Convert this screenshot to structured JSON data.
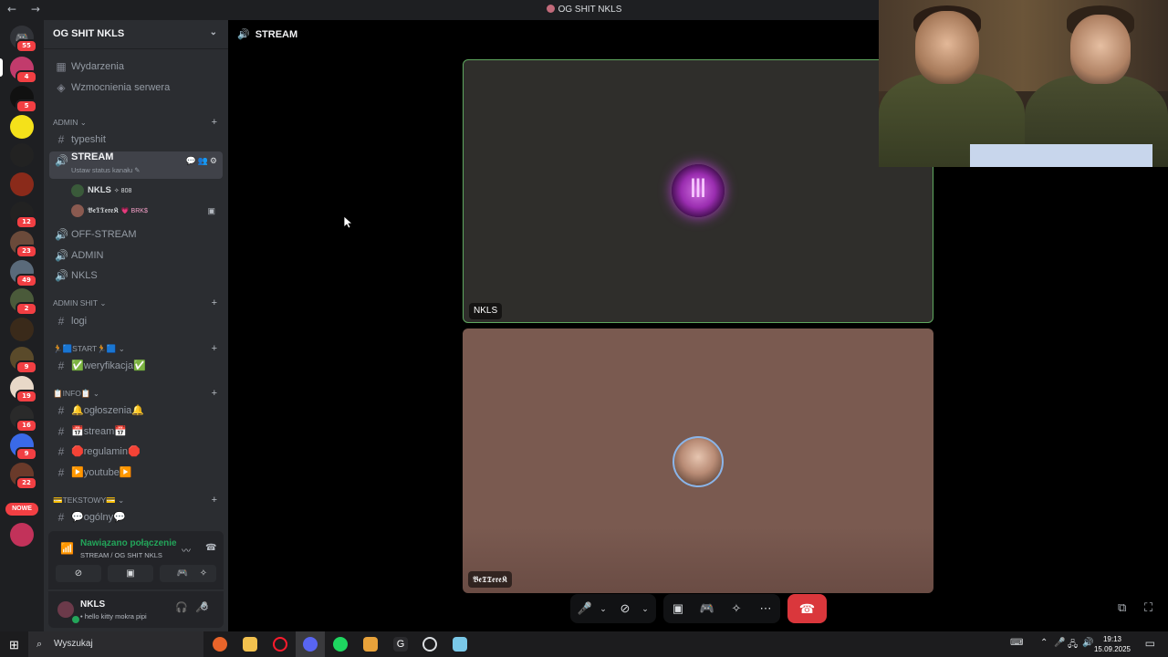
{
  "window": {
    "title": "OG SHIT NKLS",
    "nav_arrows": "← →"
  },
  "servers": {
    "home_badge": "55",
    "items": [
      {
        "badge": "4",
        "color": "#c23b6c"
      },
      {
        "badge": "5",
        "color": "#111111"
      },
      {
        "badge": "",
        "color": "#f4e11a"
      },
      {
        "badge": "",
        "color": "#222222"
      },
      {
        "badge": "",
        "color": "#8a2a1a"
      },
      {
        "badge": "12",
        "color": "#222222"
      },
      {
        "badge": "23",
        "color": "#6b4a3a"
      },
      {
        "badge": "49",
        "color": "#5a6a7a"
      },
      {
        "badge": "2",
        "color": "#4a5a3a"
      },
      {
        "badge": "",
        "color": "#3a2a1a"
      },
      {
        "badge": "9",
        "color": "#5a4a2a"
      },
      {
        "badge": "19",
        "color": "#e8d8c8"
      },
      {
        "badge": "16",
        "color": "#2a2a2a"
      },
      {
        "badge": "9",
        "color": "#3a6ae8"
      },
      {
        "badge": "22",
        "color": "#6a3a2a"
      }
    ],
    "new_label": "NOWE"
  },
  "sidebar": {
    "guild_name": "OG SHIT NKLS",
    "top_links": [
      {
        "label": "Wydarzenia",
        "icon": "calendar-icon"
      },
      {
        "label": "Wzmocnienia serwera",
        "icon": "boost-icon"
      }
    ],
    "categories": {
      "admin": "ADMIN",
      "admin_shit": "ADMIN SHIT",
      "start": "🏃🟦START🏃🟦",
      "info": "📋INFO📋",
      "tekstowy": "💳TEKSTOWY💳"
    },
    "channels": {
      "typeshit": "typeshit",
      "stream": "STREAM",
      "stream_sub": "Ustaw status kanału",
      "off_stream": "OFF-STREAM",
      "admin": "ADMIN",
      "nkls": "NKLS",
      "logi": "logi",
      "weryfikacja": "✅weryfikacja✅",
      "ogloszenia": "🔔ogłoszenia🔔",
      "stream_text": "📅stream📅",
      "regulamin": "🛑regulamin🛑",
      "youtube": "▶️youtube▶️",
      "ogolny": "💬ogólny💬"
    },
    "members": [
      {
        "name": "NKLS",
        "tag": "✧ 808",
        "color": "#3a5a3a"
      },
      {
        "name": "𝕭𝖊𝕿𝕿𝖊𝖗𝖊𝕶",
        "tag": "💗 BRK$",
        "color": "#8a5a50"
      }
    ],
    "voice": {
      "status": "Nawiązano połączenie",
      "channel": "STREAM / OG SHIT NKLS"
    },
    "user": {
      "name": "NKLS",
      "status": "hello kitty mokra pipi"
    }
  },
  "main": {
    "channel_title": "STREAM",
    "tiles": [
      {
        "name": "NKLS"
      },
      {
        "name": "𝕭𝖊𝕿𝕿𝖊𝖗𝖊𝕶"
      }
    ]
  },
  "taskbar": {
    "search_placeholder": "Wyszukaj",
    "time": "19:13",
    "date": "15.09.2025"
  }
}
